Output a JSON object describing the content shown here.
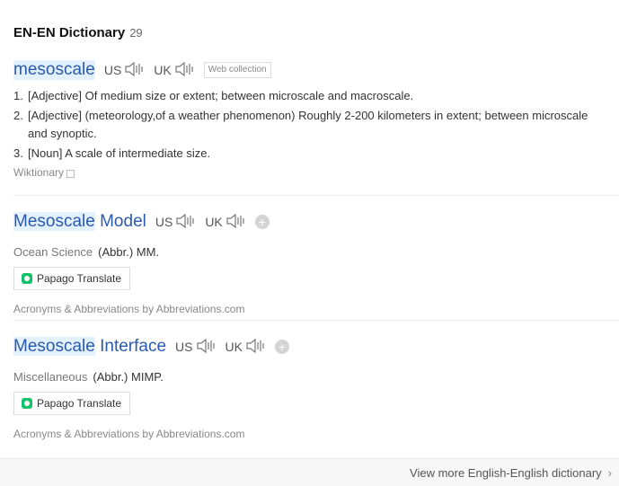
{
  "header": {
    "title": "EN-EN Dictionary",
    "count": "29"
  },
  "entries": [
    {
      "word": "mesoscale",
      "us_label": "US",
      "uk_label": "UK",
      "tag": "Web collection",
      "definitions": [
        {
          "num": "1.",
          "text": "[Adjective] Of medium size or extent; between microscale and macroscale."
        },
        {
          "num": "2.",
          "text": "[Adjective] (meteorology,of a weather phenomenon) Roughly 2-200 kilometers in extent; between microscale and synoptic."
        },
        {
          "num": "3.",
          "text": "[Noun] A scale of intermediate size."
        }
      ],
      "source": "Wiktionary"
    },
    {
      "word_hl": "Mesoscale",
      "word_rest": " Model",
      "us_label": "US",
      "uk_label": "UK",
      "category": "Ocean Science",
      "abbr": "(Abbr.) MM.",
      "translate_label": "Papago Translate",
      "source": "Acronyms & Abbreviations by Abbreviations.com"
    },
    {
      "word_hl": "Mesoscale",
      "word_rest": " Interface",
      "us_label": "US",
      "uk_label": "UK",
      "category": "Miscellaneous",
      "abbr": "(Abbr.) MIMP.",
      "translate_label": "Papago Translate",
      "source": "Acronyms & Abbreviations by Abbreviations.com"
    }
  ],
  "footer": {
    "more_label": "View more English-English dictionary"
  },
  "icons": {
    "speaker": "speaker-icon",
    "plus": "plus-icon",
    "copy": "copy-icon",
    "chevron": "chevron-right-icon",
    "papago": "papago-logo-icon"
  },
  "colors": {
    "word": "#2a5aad",
    "highlight": "#e3f0fd",
    "papago": "#13c26b"
  }
}
